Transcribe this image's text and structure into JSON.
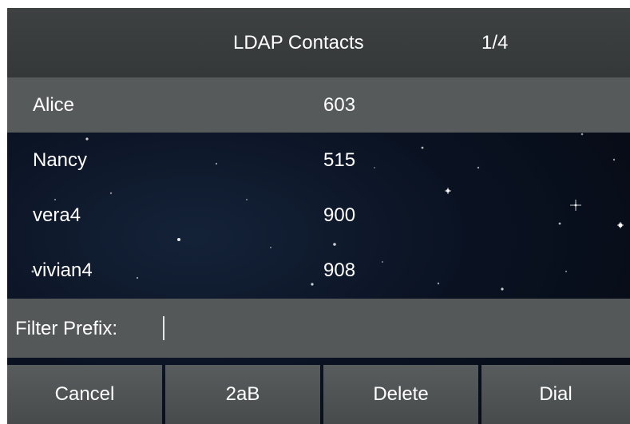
{
  "header": {
    "title": "LDAP Contacts",
    "page_indicator": "1/4"
  },
  "contacts": [
    {
      "name": "Alice",
      "number": "603",
      "selected": true
    },
    {
      "name": "Nancy",
      "number": "515",
      "selected": false
    },
    {
      "name": "vera4",
      "number": "900",
      "selected": false
    },
    {
      "name": "vivian4",
      "number": "908",
      "selected": false
    }
  ],
  "filter": {
    "label": "Filter Prefix:",
    "value": ""
  },
  "softkeys": {
    "cancel": "Cancel",
    "input_mode": "2aB",
    "delete": "Delete",
    "dial": "Dial"
  },
  "colors": {
    "header_bar": "#3a3d3e",
    "selected_row": "#575a5b",
    "filter_bar": "#545859",
    "softkey": "#4f5354",
    "text": "#ffffff",
    "background": "#0a1222"
  }
}
